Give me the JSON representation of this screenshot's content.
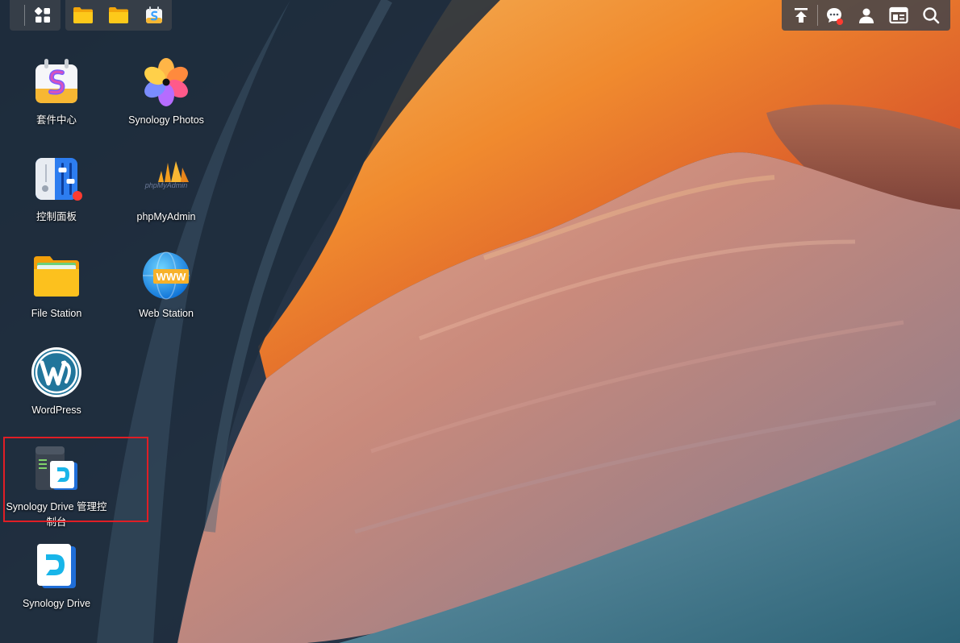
{
  "taskbar": {
    "main_menu_icon": "apps-grid-icon",
    "pinned": [
      {
        "name": "folder-icon"
      },
      {
        "name": "folder-icon"
      },
      {
        "name": "package-center-icon"
      }
    ],
    "tray": [
      {
        "name": "upload-icon"
      },
      {
        "name": "notification-chat-icon"
      },
      {
        "name": "user-icon"
      },
      {
        "name": "widgets-icon"
      },
      {
        "name": "search-icon"
      }
    ]
  },
  "desktop": {
    "icons": [
      {
        "label": "套件中心"
      },
      {
        "label": "Synology Photos"
      },
      {
        "label": "控制面板"
      },
      {
        "label": "phpMyAdmin"
      },
      {
        "label": "File Station"
      },
      {
        "label": "Web Station"
      },
      {
        "label": "WordPress"
      },
      {
        "label": "Synology Drive 管理控制台"
      },
      {
        "label": "Synology Drive"
      }
    ],
    "phpmyadmin_logo_text": "phpMyAdmin",
    "web_station_badge": "WWW"
  },
  "colors": {
    "highlight": "#e01e25",
    "notification_dot": "#ff3b30"
  }
}
